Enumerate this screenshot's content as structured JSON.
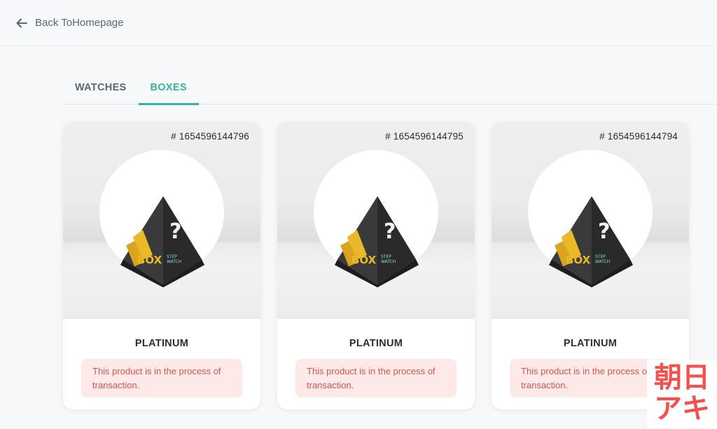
{
  "header": {
    "back_label": "Back ToHomepage"
  },
  "tabs": [
    {
      "label": "WATCHES",
      "active": false
    },
    {
      "label": "BOXES",
      "active": true
    }
  ],
  "cards": [
    {
      "id_text": "# 1654596144796",
      "title": "PLATINUM",
      "notice": "This product is in the process of transaction.",
      "image_text": {
        "mark": "?",
        "brand": "BOX",
        "sub1": "STEP",
        "sub2": "WATCH"
      }
    },
    {
      "id_text": "# 1654596144795",
      "title": "PLATINUM",
      "notice": "This product is in the process of transaction.",
      "image_text": {
        "mark": "?",
        "brand": "BOX",
        "sub1": "STEP",
        "sub2": "WATCH"
      }
    },
    {
      "id_text": "# 1654596144794",
      "title": "PLATINUM",
      "notice": "This product is in the process of transaction.",
      "image_text": {
        "mark": "?",
        "brand": "BOX",
        "sub1": "STEP",
        "sub2": "WATCH"
      }
    }
  ],
  "watermark": {
    "line1": "朝日",
    "line2": "アキ"
  },
  "colors": {
    "accent": "#35b5a0",
    "notice_bg": "#fde9e8",
    "notice_text": "#e0554d",
    "watermark": "#f4504f"
  }
}
